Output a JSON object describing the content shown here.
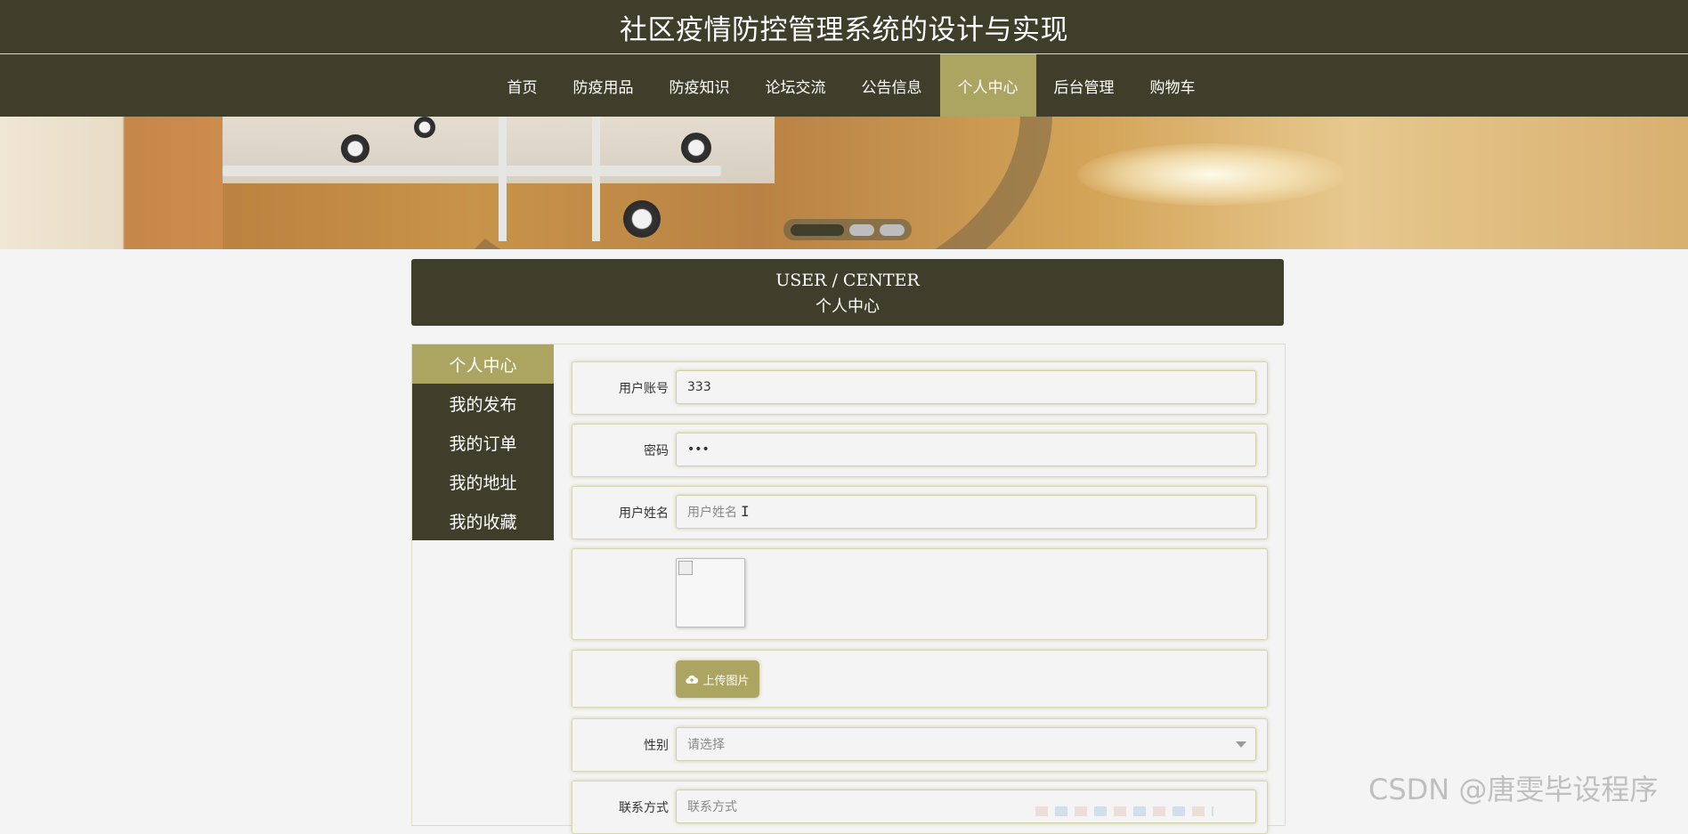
{
  "site": {
    "title": "社区疫情防控管理系统的设计与实现"
  },
  "nav": {
    "items": [
      {
        "label": "首页"
      },
      {
        "label": "防疫用品"
      },
      {
        "label": "防疫知识"
      },
      {
        "label": "论坛交流"
      },
      {
        "label": "公告信息"
      },
      {
        "label": "个人中心",
        "active": true
      },
      {
        "label": "后台管理"
      },
      {
        "label": "购物车"
      }
    ]
  },
  "carousel": {
    "slide_count": 3,
    "active_index": 0
  },
  "user_center": {
    "title_en": "USER / CENTER",
    "title_cn": "个人中心"
  },
  "sidebar": {
    "items": [
      {
        "label": "个人中心",
        "active": true
      },
      {
        "label": "我的发布"
      },
      {
        "label": "我的订单"
      },
      {
        "label": "我的地址"
      },
      {
        "label": "我的收藏"
      }
    ]
  },
  "form": {
    "account": {
      "label": "用户账号",
      "value": "333"
    },
    "password": {
      "label": "密码",
      "value": "•••"
    },
    "name": {
      "label": "用户姓名",
      "placeholder": "用户姓名"
    },
    "upload": {
      "label": "上传图片",
      "icon": "cloud-upload-icon"
    },
    "gender": {
      "label": "性别",
      "selected": "请选择"
    },
    "phone": {
      "label": "联系方式",
      "placeholder": "联系方式"
    }
  },
  "watermark": "CSDN @唐雯毕设程序",
  "colors": {
    "primary": "#3e3e2a",
    "accent": "#aba561",
    "background": "#f4f4f4"
  }
}
